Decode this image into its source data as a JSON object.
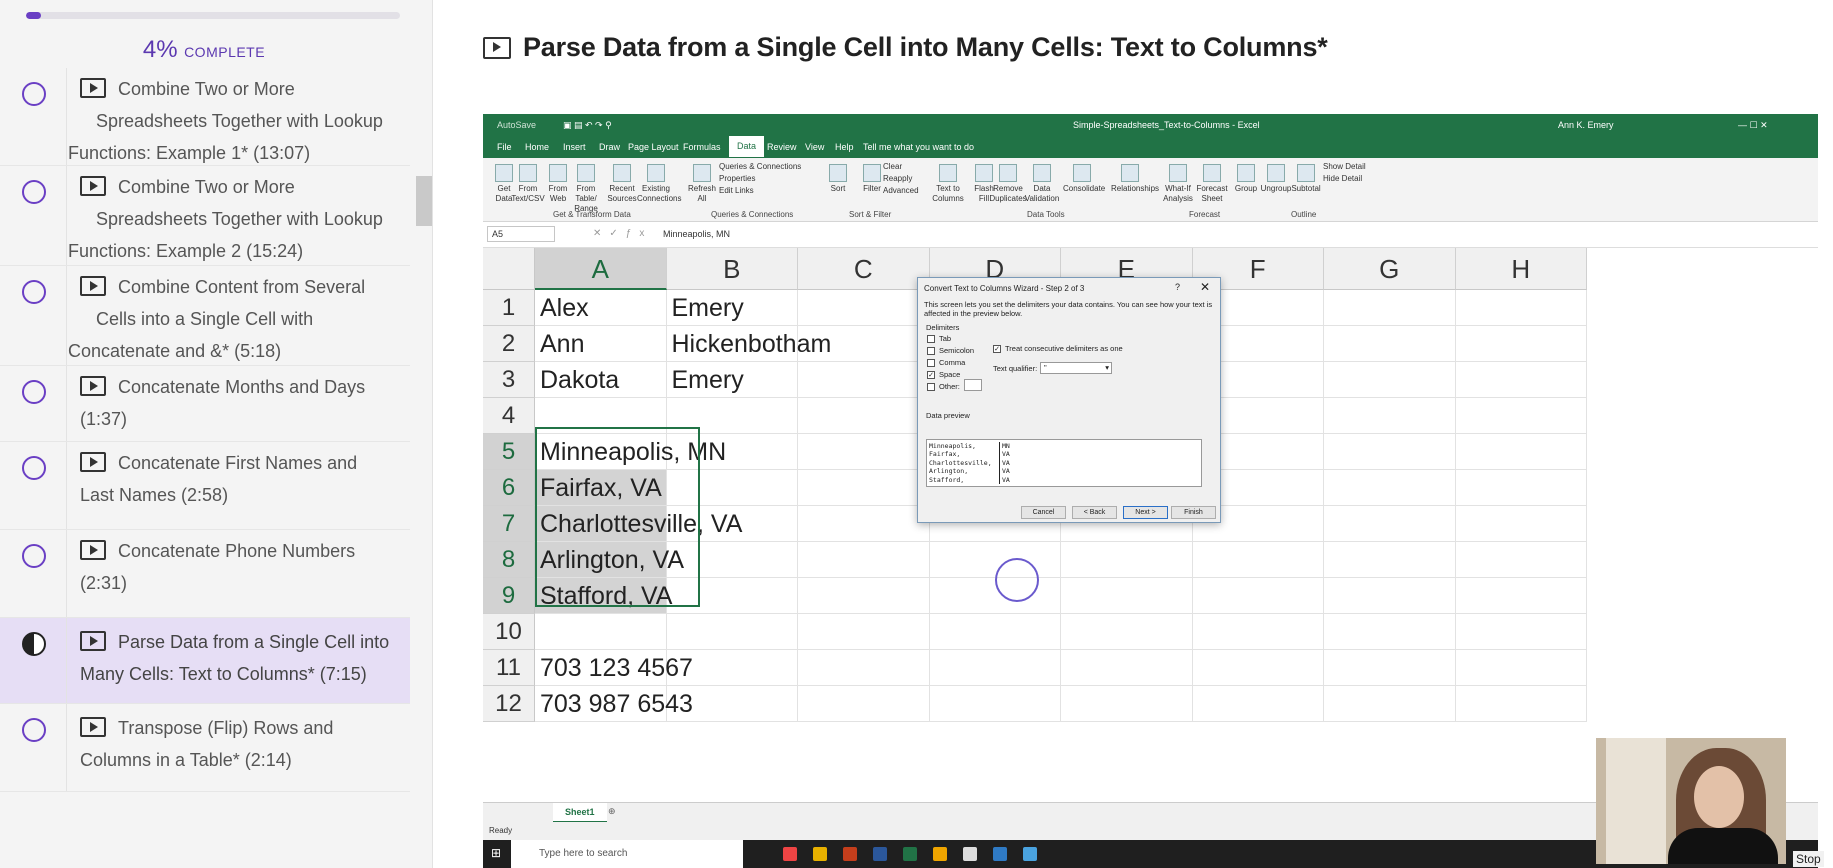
{
  "progress": {
    "percent": "4%",
    "label": "COMPLETE",
    "fill": 0.04
  },
  "lessons": [
    {
      "title": "Combine Two or More Spreadsheets Together with Lookup Functions: Example 1* (13:07)",
      "lines": [
        "Combine Two or More",
        "Spreadsheets Together with Lookup",
        "Functions: Example 1* (13:07)"
      ],
      "status": "empty"
    },
    {
      "title": "Combine Two or More Spreadsheets Together with Lookup Functions: Example 2 (15:24)",
      "lines": [
        "Combine Two or More",
        "Spreadsheets Together with Lookup",
        "Functions: Example 2 (15:24)"
      ],
      "status": "empty"
    },
    {
      "title": "Combine Content from Several Cells into a Single Cell with Concatenate and &* (5:18)",
      "lines": [
        "Combine Content from Several",
        "Cells into a Single Cell with",
        "Concatenate and &* (5:18)"
      ],
      "status": "empty"
    },
    {
      "lines": [
        "Concatenate Months and Days",
        "(1:37)"
      ],
      "status": "empty"
    },
    {
      "lines": [
        "Concatenate First Names and",
        "Last Names (2:58)"
      ],
      "status": "empty"
    },
    {
      "lines": [
        "Concatenate Phone Numbers",
        "(2:31)"
      ],
      "status": "empty"
    },
    {
      "lines": [
        "Parse Data from a Single Cell into",
        "Many Cells: Text to Columns* (7:15)"
      ],
      "status": "half",
      "active": true
    },
    {
      "lines": [
        "Transpose (Flip) Rows and",
        "Columns in a Table* (2:14)"
      ],
      "status": "empty"
    }
  ],
  "lecture_title": "Parse Data from a Single Cell into Many Cells: Text to Columns*",
  "excel": {
    "autosave": "AutoSave",
    "window_title": "Simple-Spreadsheets_Text-to-Columns - Excel",
    "user": "Ann K. Emery",
    "menu": [
      "File",
      "Home",
      "Insert",
      "Draw",
      "Page Layout",
      "Formulas",
      "Data",
      "Review",
      "View",
      "Help",
      "Tell me what you want to do"
    ],
    "ribbon": [
      [
        "Get",
        "Data"
      ],
      [
        "From",
        "Text/CSV"
      ],
      [
        "From",
        "Web"
      ],
      [
        "From Table/",
        "Range"
      ],
      [
        "Recent",
        "Sources"
      ],
      [
        "Existing",
        "Connections"
      ],
      [
        "Refresh",
        "All"
      ],
      [
        "Sort"
      ],
      [
        "Filter"
      ],
      [
        "Text to",
        "Columns"
      ],
      [
        "Flash",
        "Fill"
      ],
      [
        "Remove",
        "Duplicates"
      ],
      [
        "Data",
        "Validation"
      ],
      [
        "Consolidate"
      ],
      [
        "Relationships"
      ],
      [
        "What-If",
        "Analysis"
      ],
      [
        "Forecast",
        "Sheet"
      ],
      [
        "Group"
      ],
      [
        "Ungroup"
      ],
      [
        "Subtotal"
      ]
    ],
    "ribbon_small": [
      "Queries & Connections",
      "Properties",
      "Edit Links",
      "Clear",
      "Reapply",
      "Advanced",
      "Show Detail",
      "Hide Detail"
    ],
    "ribbon_groups": [
      "Get & Transform Data",
      "Queries & Connections",
      "Sort & Filter",
      "Data Tools",
      "Forecast",
      "Outline"
    ],
    "name_box": "A5",
    "formula_value": "Minneapolis, MN",
    "columns": [
      "A",
      "B",
      "C",
      "D",
      "E",
      "F",
      "G",
      "H"
    ],
    "rows": [
      {
        "n": "1",
        "a": "Alex",
        "b": "Emery"
      },
      {
        "n": "2",
        "a": "Ann",
        "b": "Hickenbotham"
      },
      {
        "n": "3",
        "a": "Dakota",
        "b": "Emery"
      },
      {
        "n": "4",
        "a": "",
        "b": ""
      },
      {
        "n": "5",
        "a": "Minneapolis, MN",
        "b": ""
      },
      {
        "n": "6",
        "a": "Fairfax, VA",
        "b": ""
      },
      {
        "n": "7",
        "a": "Charlottesville, VA",
        "b": ""
      },
      {
        "n": "8",
        "a": "Arlington, VA",
        "b": ""
      },
      {
        "n": "9",
        "a": "Stafford, VA",
        "b": ""
      },
      {
        "n": "10",
        "a": "",
        "b": ""
      },
      {
        "n": "11",
        "a": "703 123 4567",
        "b": ""
      },
      {
        "n": "12",
        "a": "703 987 6543",
        "b": ""
      }
    ],
    "sheet_tab": "Sheet1",
    "status": "Ready",
    "taskbar_search": "Type here to search"
  },
  "dialog": {
    "title": "Convert Text to Columns Wizard - Step 2 of 3",
    "help": "?",
    "close": "✕",
    "description": "This screen lets you set the delimiters your data contains. You can see how your text is affected in the preview below.",
    "delimiters_title": "Delimiters",
    "delimiters": [
      {
        "label": "Tab",
        "checked": false
      },
      {
        "label": "Semicolon",
        "checked": false
      },
      {
        "label": "Comma",
        "checked": false
      },
      {
        "label": "Space",
        "checked": true
      },
      {
        "label": "Other:",
        "checked": false
      }
    ],
    "consecutive": "Treat consecutive delimiters as one",
    "qualifier_label": "Text qualifier:",
    "qualifier_value": "\"",
    "preview_title": "Data preview",
    "preview_col1": [
      "Minneapolis,",
      "Fairfax,",
      "Charlottesville,",
      "Arlington,",
      "Stafford,"
    ],
    "preview_col2": [
      "MN",
      "VA",
      "VA",
      "VA",
      "VA"
    ],
    "buttons": [
      "Cancel",
      "< Back",
      "Next >",
      "Finish"
    ]
  },
  "stop_label": "Stop",
  "colors": {
    "accent": "#6a3fc4",
    "excel_green": "#217346"
  }
}
